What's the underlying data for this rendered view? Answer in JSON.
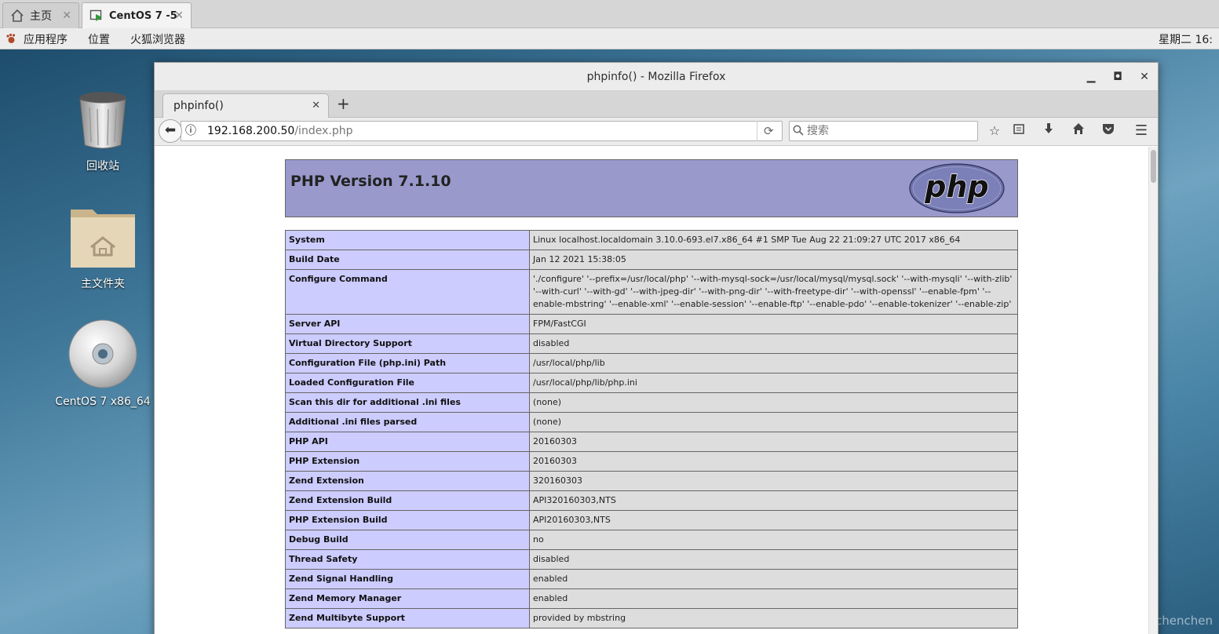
{
  "vm_tabs": {
    "home_label": "主页",
    "centos_label": "CentOS 7 -5"
  },
  "gnome_bar": {
    "applications": "应用程序",
    "places": "位置",
    "firefox": "火狐浏览器",
    "clock": "星期二 16:"
  },
  "desktop": {
    "trash_label": "回收站",
    "home_folder_label": "主文件夹",
    "cdrom_label": "CentOS 7 x86_64"
  },
  "firefox": {
    "window_title": "phpinfo() - Mozilla Firefox",
    "tab_title": "phpinfo()",
    "url_host": "192.168.200.50",
    "url_path": "/index.php",
    "search_placeholder": "搜索"
  },
  "php": {
    "version": "PHP Version 7.1.10",
    "logo_text": "php",
    "rows": [
      {
        "key": "System",
        "value": "Linux localhost.localdomain 3.10.0-693.el7.x86_64 #1 SMP Tue Aug 22 21:09:27 UTC 2017 x86_64"
      },
      {
        "key": "Build Date",
        "value": "Jan 12 2021 15:38:05"
      },
      {
        "key": "Configure Command",
        "value": "'./configure' '--prefix=/usr/local/php' '--with-mysql-sock=/usr/local/mysql/mysql.sock' '--with-mysqli' '--with-zlib' '--with-curl' '--with-gd' '--with-jpeg-dir' '--with-png-dir' '--with-freetype-dir' '--with-openssl' '--enable-fpm' '--enable-mbstring' '--enable-xml' '--enable-session' '--enable-ftp' '--enable-pdo' '--enable-tokenizer' '--enable-zip'"
      },
      {
        "key": "Server API",
        "value": "FPM/FastCGI"
      },
      {
        "key": "Virtual Directory Support",
        "value": "disabled"
      },
      {
        "key": "Configuration File (php.ini) Path",
        "value": "/usr/local/php/lib"
      },
      {
        "key": "Loaded Configuration File",
        "value": "/usr/local/php/lib/php.ini"
      },
      {
        "key": "Scan this dir for additional .ini files",
        "value": "(none)"
      },
      {
        "key": "Additional .ini files parsed",
        "value": "(none)"
      },
      {
        "key": "PHP API",
        "value": "20160303"
      },
      {
        "key": "PHP Extension",
        "value": "20160303"
      },
      {
        "key": "Zend Extension",
        "value": "320160303"
      },
      {
        "key": "Zend Extension Build",
        "value": "API320160303,NTS"
      },
      {
        "key": "PHP Extension Build",
        "value": "API20160303,NTS"
      },
      {
        "key": "Debug Build",
        "value": "no"
      },
      {
        "key": "Thread Safety",
        "value": "disabled"
      },
      {
        "key": "Zend Signal Handling",
        "value": "enabled"
      },
      {
        "key": "Zend Memory Manager",
        "value": "enabled"
      },
      {
        "key": "Zend Multibyte Support",
        "value": "provided by mbstring"
      }
    ]
  },
  "watermark": "https://blog.csdn.net/Gengchenchen",
  "colors": {
    "php_header": "#9999cc",
    "php_key_cell": "#ccccff",
    "php_value_cell": "#dddddd"
  }
}
